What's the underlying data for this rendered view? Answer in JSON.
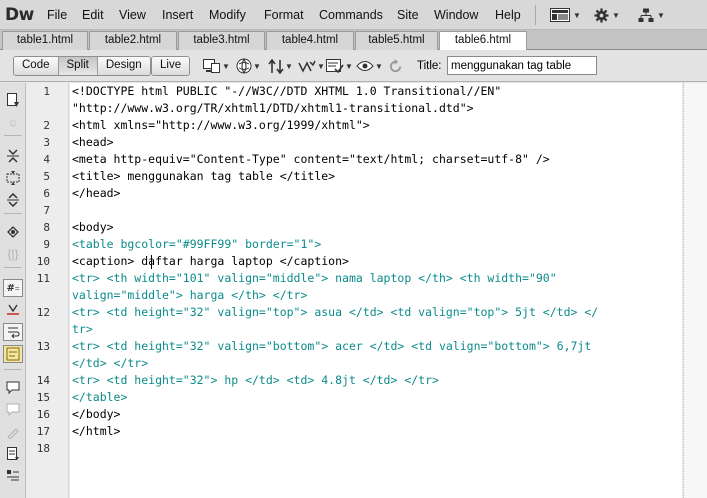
{
  "app": {
    "logo": "Dw"
  },
  "menu": [
    "File",
    "Edit",
    "View",
    "Insert",
    "Modify",
    "Format",
    "Commands",
    "Site",
    "Window",
    "Help"
  ],
  "menu_right_icons": [
    "layout-icon",
    "gear-icon",
    "site-icon"
  ],
  "tabs": [
    "table1.html",
    "table2.html",
    "table3.html",
    "table4.html",
    "table5.html",
    "table6.html"
  ],
  "active_tab": "table6.html",
  "toolbar": {
    "views": [
      "Code",
      "Split",
      "Design"
    ],
    "live": "Live",
    "active_view": "Split",
    "title_label": "Title:",
    "title_value": "menggunakan tag table"
  },
  "line_numbers": [
    "1",
    "2",
    "3",
    "4",
    "5",
    "6",
    "7",
    "8",
    "9",
    "10",
    "11",
    "12",
    "13",
    "14",
    "15",
    "16",
    "17",
    "18"
  ],
  "code_lines": [
    "<!DOCTYPE html PUBLIC \"-//W3C//DTD XHTML 1.0 Transitional//EN\"",
    "\"http://www.w3.org/TR/xhtml1/DTD/xhtml1-transitional.dtd\">",
    "<html xmlns=\"http://www.w3.org/1999/xhtml\">",
    "<head>",
    "<meta http-equiv=\"Content-Type\" content=\"text/html; charset=utf-8\" />",
    "<title> menggunakan tag table </title>",
    "</head>",
    "",
    "<body>",
    "<table bgcolor=\"#99FF99\" border=\"1\">",
    "<caption> daftar harga laptop </caption>",
    "<tr> <th width=\"101\" valign=\"middle\"> nama laptop </th> <th width=\"90\"",
    "valign=\"middle\"> harga </th> </tr>",
    "<tr> <td height=\"32\" valign=\"top\"> asua </td> <td valign=\"top\"> 5jt </td> </",
    "tr>",
    "<tr> <td height=\"32\" valign=\"bottom\"> acer </td> <td valign=\"bottom\"> 6,7jt",
    "</td> </tr>",
    "<tr> <td height=\"32\"> hp </td> <td> 4.8jt </td> </tr>",
    "</table>",
    "</body>",
    "</html>",
    ""
  ],
  "colors": {
    "tag": "#0b8b8b",
    "text": "#000000",
    "active_tab": "#ffffff"
  }
}
